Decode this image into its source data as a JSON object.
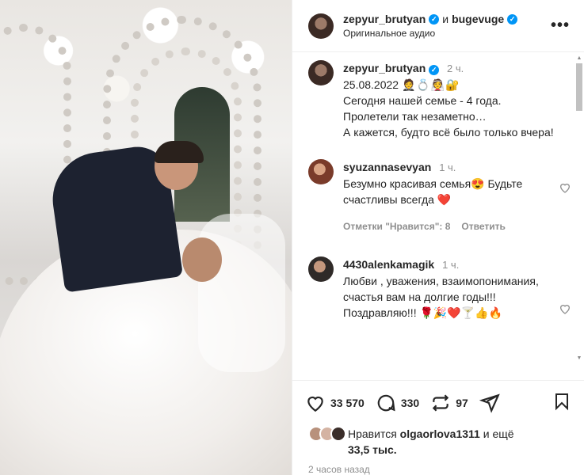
{
  "header": {
    "author": "zepyur_brutyan",
    "and": "и",
    "coauthor": "bugevuge",
    "audio": "Оригинальное аудио",
    "more_label": "•••"
  },
  "caption": {
    "username": "zepyur_brutyan",
    "time": "2 ч.",
    "date": "25.08.2022",
    "emojis": "🤵💍👰🔐",
    "lines": [
      "Сегодня нашей семье - 4 года.",
      "Пролетели так незаметно…",
      "А кажется, будто всё было только вчера!"
    ]
  },
  "comments": [
    {
      "username": "syuzannasevyan",
      "time": "1 ч.",
      "text": "Безумно красивая семья😍 Будьте счастливы всегда ❤️",
      "likes_label": "Отметки \"Нравится\": 8",
      "reply_label": "Ответить"
    },
    {
      "username": "4430alenkamagik",
      "time": "1 ч.",
      "text": "Любви , уважения, взаимопонимания, счастья вам на долгие годы!!! Поздравляю!!! 🌹🎉❤️🍸👍🔥"
    }
  ],
  "actions": {
    "likes_count": "33 570",
    "comments_count": "330",
    "reposts_count": "97"
  },
  "liked_by": {
    "prefix": "Нравится",
    "user": "olgaorlova1311",
    "suffix": "и ещё",
    "more": "33,5 тыс."
  },
  "posted_ago": "2 часов назад",
  "colors": {
    "verified": "#0095f6",
    "muted": "#8e8e8e",
    "text": "#262626"
  }
}
